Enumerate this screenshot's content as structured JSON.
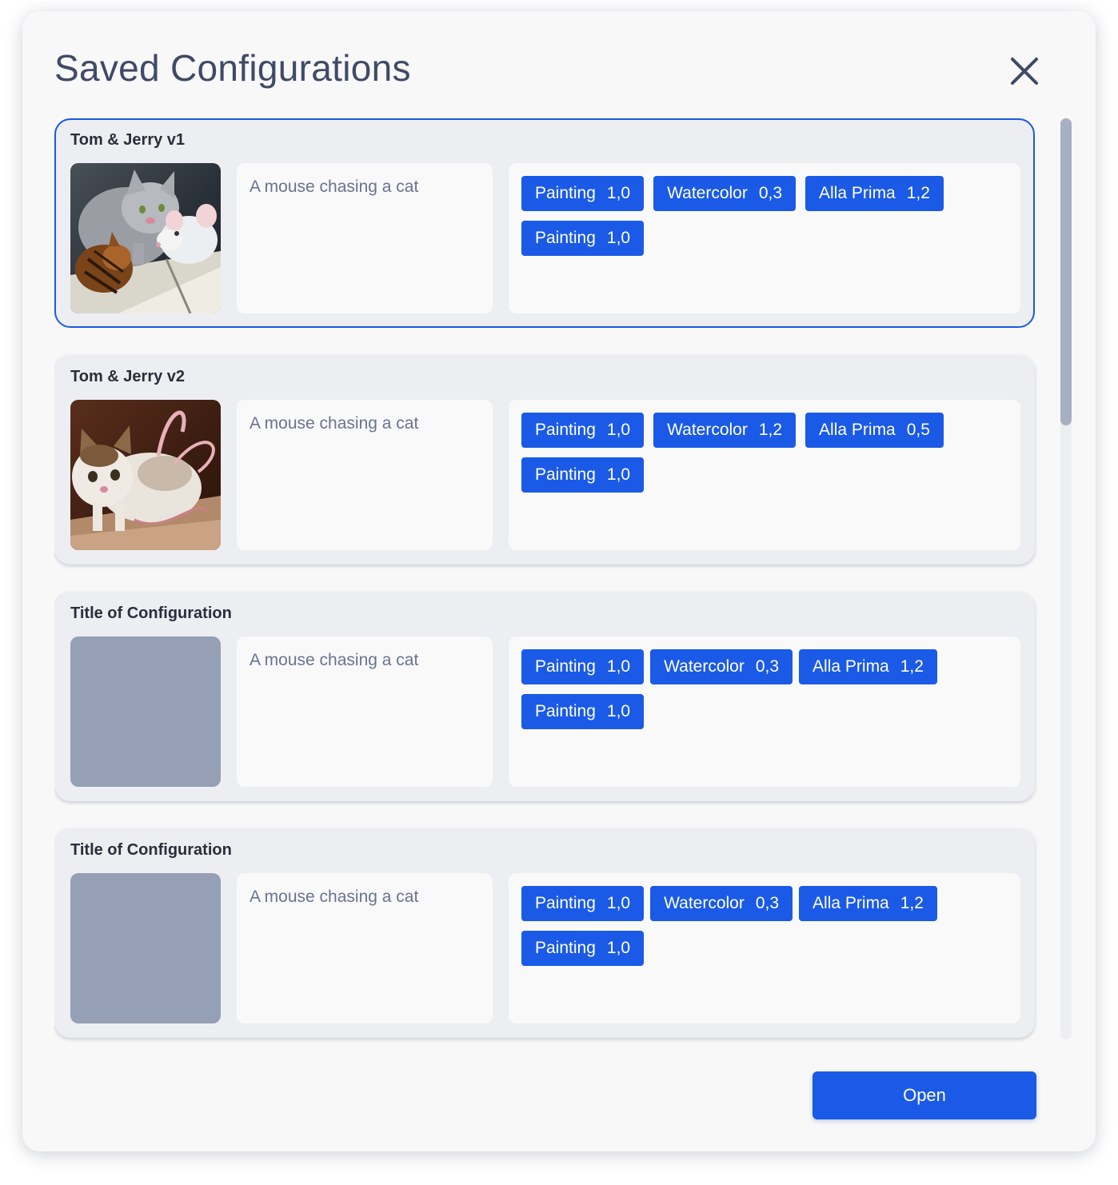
{
  "dialog": {
    "title": "Saved Configurations",
    "close_icon": "close-icon",
    "open_label": "Open"
  },
  "colors": {
    "accent": "#1a5ae6",
    "title_text": "#3f4a66",
    "card_bg": "#edeef2",
    "placeholder_thumb": "#95a0b6"
  },
  "configurations": [
    {
      "title": "Tom & Jerry v1",
      "selected": true,
      "thumbnail": "cat-and-mouse-painting-1",
      "prompt": "A mouse chasing a cat",
      "styles": [
        {
          "name": "Painting",
          "value": "1,0"
        },
        {
          "name": "Watercolor",
          "value": "0,3"
        },
        {
          "name": "Alla Prima",
          "value": "1,2"
        },
        {
          "name": "Painting",
          "value": "1,0"
        }
      ]
    },
    {
      "title": "Tom & Jerry v2",
      "selected": false,
      "thumbnail": "cat-and-mouse-painting-2",
      "prompt": "A mouse chasing a cat",
      "styles": [
        {
          "name": "Painting",
          "value": "1,0"
        },
        {
          "name": "Watercolor",
          "value": "1,2"
        },
        {
          "name": "Alla Prima",
          "value": "0,5"
        },
        {
          "name": "Painting",
          "value": "1,0"
        }
      ]
    },
    {
      "title": "Title of Configuration",
      "selected": false,
      "thumbnail": "placeholder",
      "prompt": "A mouse chasing a cat",
      "styles": [
        {
          "name": "Painting",
          "value": "1,0"
        },
        {
          "name": "Watercolor",
          "value": "0,3"
        },
        {
          "name": "Alla Prima",
          "value": "1,2"
        },
        {
          "name": "Painting",
          "value": "1,0"
        }
      ]
    },
    {
      "title": "Title of Configuration",
      "selected": false,
      "thumbnail": "placeholder",
      "prompt": "A mouse chasing a cat",
      "styles": [
        {
          "name": "Painting",
          "value": "1,0"
        },
        {
          "name": "Watercolor",
          "value": "0,3"
        },
        {
          "name": "Alla Prima",
          "value": "1,2"
        },
        {
          "name": "Painting",
          "value": "1,0"
        }
      ]
    }
  ]
}
